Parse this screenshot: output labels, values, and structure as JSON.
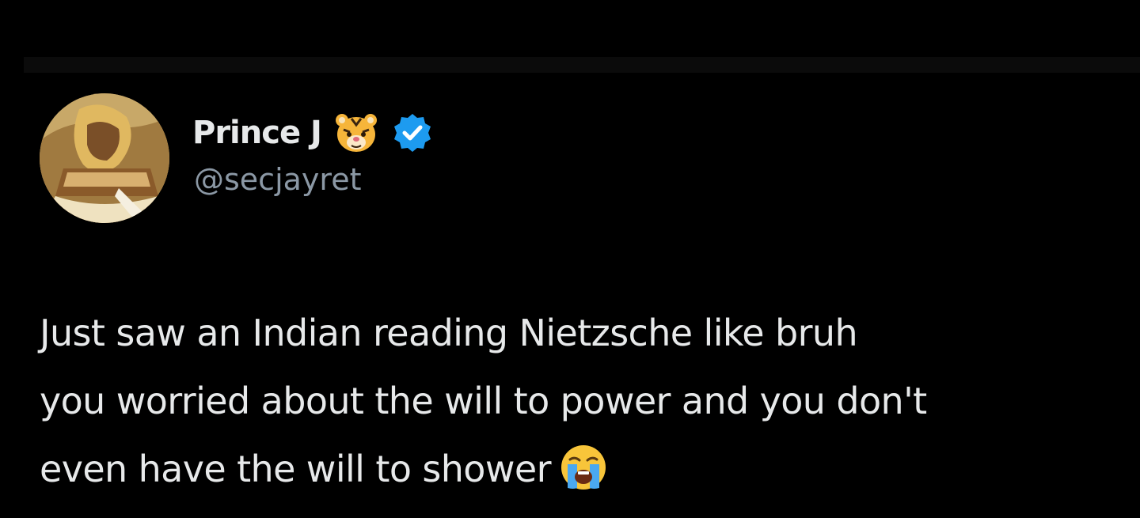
{
  "tweet": {
    "author": {
      "display_name": "Prince J",
      "handle": "@secjayret",
      "name_emoji_icon": "tiger-face-icon",
      "verified_badge_icon": "verified-badge-icon",
      "verified_badge_color": "#1d9bf0"
    },
    "body_lines": [
      "Just saw an Indian reading Nietzsche like bruh",
      "you worried about the will to power and you don't",
      "even have the will to shower"
    ],
    "trailing_emoji_icon": "loudly-crying-face-icon"
  },
  "colors": {
    "background": "#000000",
    "text_primary": "#e7e9ea",
    "text_secondary": "#8b98a5"
  }
}
